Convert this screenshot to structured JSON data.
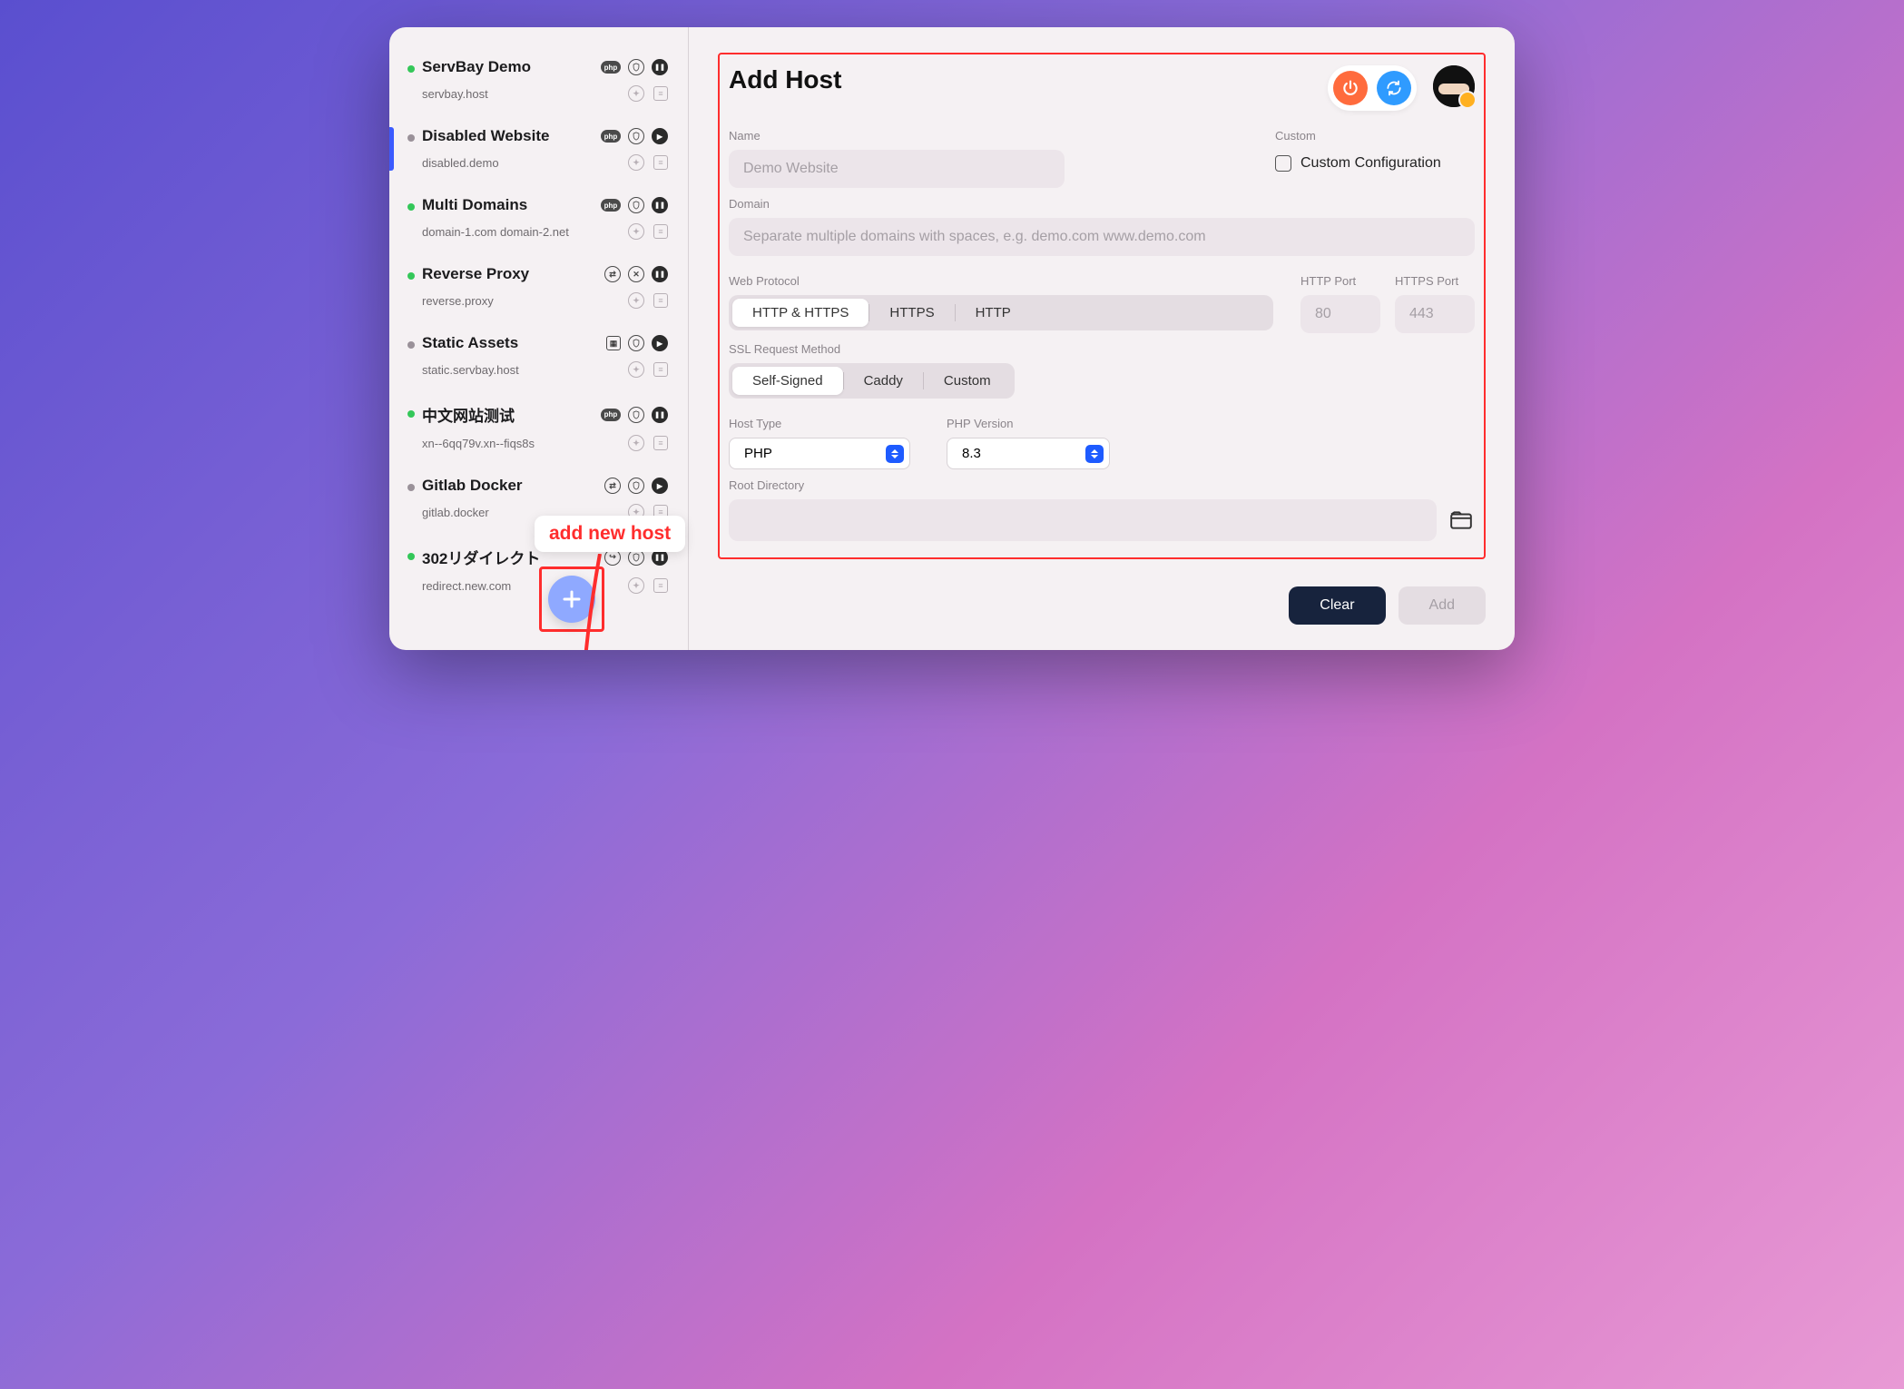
{
  "sidebar": {
    "hosts": [
      {
        "name": "ServBay Demo",
        "domain": "servbay.host",
        "status": "green",
        "icons": {
          "tech": "php",
          "shield": "lock",
          "action": "pause"
        },
        "sub": {
          "a": "compass",
          "b": "note"
        }
      },
      {
        "name": "Disabled Website",
        "domain": "disabled.demo",
        "status": "gray",
        "icons": {
          "tech": "php",
          "shield": "lock",
          "action": "play"
        },
        "sub": {
          "a": "compass",
          "b": "note"
        },
        "selected": true
      },
      {
        "name": "Multi Domains",
        "domain": "domain-1.com domain-2.net",
        "status": "green",
        "icons": {
          "tech": "php",
          "shield": "lock",
          "action": "pause"
        },
        "sub": {
          "a": "compass",
          "b": "note"
        }
      },
      {
        "name": "Reverse Proxy",
        "domain": "reverse.proxy",
        "status": "green",
        "icons": {
          "tech": "swap",
          "shield": "x",
          "action": "pause"
        },
        "sub": {
          "a": "compass",
          "b": "note"
        }
      },
      {
        "name": "Static Assets",
        "domain": "static.servbay.host",
        "status": "gray",
        "icons": {
          "tech": "square",
          "shield": "lock",
          "action": "play"
        },
        "sub": {
          "a": "compass",
          "b": "note"
        }
      },
      {
        "name": "中文网站测试",
        "domain": "xn--6qq79v.xn--fiqs8s",
        "status": "green",
        "icons": {
          "tech": "php",
          "shield": "lock",
          "action": "pause"
        },
        "sub": {
          "a": "compass",
          "b": "note"
        }
      },
      {
        "name": "Gitlab Docker",
        "domain": "gitlab.docker",
        "status": "gray",
        "icons": {
          "tech": "swap",
          "shield": "lock",
          "action": "play"
        },
        "sub": {
          "a": "compass",
          "b": "note"
        }
      },
      {
        "name": "302リダイレクト",
        "domain": "redirect.new.com",
        "status": "green",
        "icons": {
          "tech": "redirect",
          "shield": "lock",
          "action": "pause"
        },
        "sub": {
          "a": "compass",
          "b": "note"
        }
      }
    ]
  },
  "callout": {
    "text": "add new host"
  },
  "main": {
    "title": "Add Host",
    "name": {
      "label": "Name",
      "placeholder": "Demo Website",
      "value": ""
    },
    "custom": {
      "label": "Custom",
      "checkbox_label": "Custom Configuration",
      "checked": false
    },
    "domain": {
      "label": "Domain",
      "placeholder": "Separate multiple domains with spaces, e.g. demo.com www.demo.com",
      "value": ""
    },
    "protocol": {
      "label": "Web Protocol",
      "options": [
        "HTTP & HTTPS",
        "HTTPS",
        "HTTP"
      ],
      "selected": "HTTP & HTTPS"
    },
    "http_port": {
      "label": "HTTP Port",
      "placeholder": "80",
      "value": ""
    },
    "https_port": {
      "label": "HTTPS Port",
      "placeholder": "443",
      "value": ""
    },
    "ssl": {
      "label": "SSL Request Method",
      "options": [
        "Self-Signed",
        "Caddy",
        "Custom"
      ],
      "selected": "Self-Signed"
    },
    "host_type": {
      "label": "Host Type",
      "value": "PHP"
    },
    "php_version": {
      "label": "PHP Version",
      "value": "8.3"
    },
    "root": {
      "label": "Root Directory",
      "value": ""
    }
  },
  "footer": {
    "clear": "Clear",
    "add": "Add"
  }
}
